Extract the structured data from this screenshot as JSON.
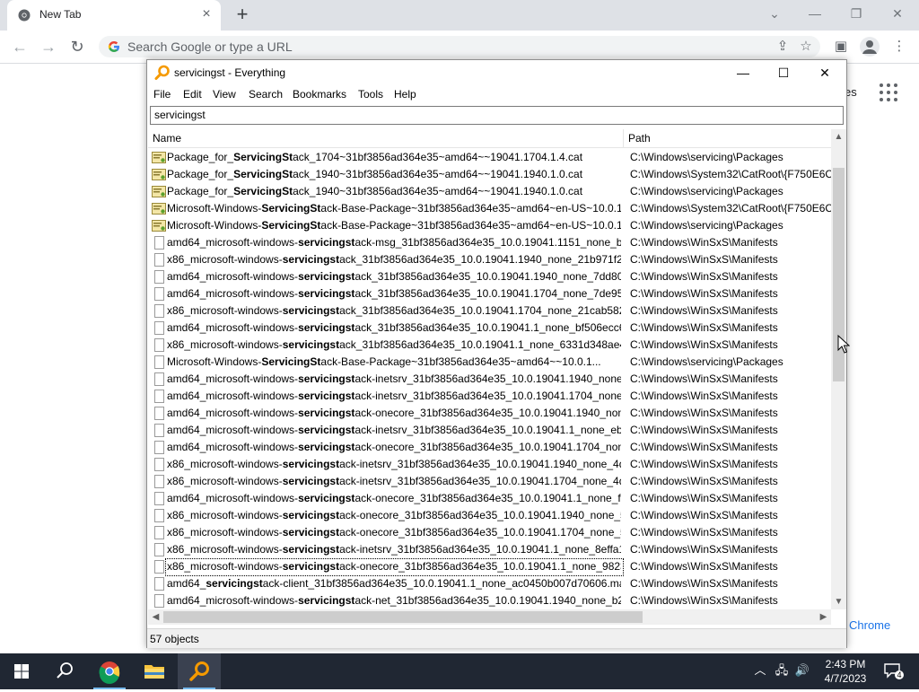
{
  "chrome": {
    "tab_title": "New Tab",
    "new_tab_label": "+",
    "omnibox_placeholder": "Search Google or type a URL",
    "ntp_link_partial": "es",
    "ntp_chrome_partial": "Chrome"
  },
  "everything": {
    "window_title": "servicingst - Everything",
    "menu": [
      "File",
      "Edit",
      "View",
      "Search",
      "Bookmarks",
      "Tools",
      "Help"
    ],
    "search_value": "servicingst",
    "columns": {
      "name": "Name",
      "path": "Path"
    },
    "rows": [
      {
        "icon": "cat",
        "pre": "Package_for_",
        "match": "ServicingSt",
        "post": "ack_1704~31bf3856ad364e35~amd64~~19041.1704.1.4.cat",
        "path": "C:\\Windows\\servicing\\Packages"
      },
      {
        "icon": "cat",
        "pre": "Package_for_",
        "match": "ServicingSt",
        "post": "ack_1940~31bf3856ad364e35~amd64~~19041.1940.1.0.cat",
        "path": "C:\\Windows\\System32\\CatRoot\\{F750E6C3"
      },
      {
        "icon": "cat",
        "pre": "Package_for_",
        "match": "ServicingSt",
        "post": "ack_1940~31bf3856ad364e35~amd64~~19041.1940.1.0.cat",
        "path": "C:\\Windows\\servicing\\Packages"
      },
      {
        "icon": "cat",
        "pre": "Microsoft-Windows-",
        "match": "ServicingSt",
        "post": "ack-Base-Package~31bf3856ad364e35~amd64~en-US~10.0.1...",
        "path": "C:\\Windows\\System32\\CatRoot\\{F750E6C3"
      },
      {
        "icon": "cat",
        "pre": "Microsoft-Windows-",
        "match": "ServicingSt",
        "post": "ack-Base-Package~31bf3856ad364e35~amd64~en-US~10.0.1...",
        "path": "C:\\Windows\\servicing\\Packages"
      },
      {
        "icon": "doc",
        "pre": "amd64_microsoft-windows-",
        "match": "servicingst",
        "post": "ack-msg_31bf3856ad364e35_10.0.19041.1151_none_b36...",
        "path": "C:\\Windows\\WinSxS\\Manifests"
      },
      {
        "icon": "doc",
        "pre": "x86_microsoft-windows-",
        "match": "servicingst",
        "post": "ack_31bf3856ad364e35_10.0.19041.1940_none_21b971f2c45...",
        "path": "C:\\Windows\\WinSxS\\Manifests"
      },
      {
        "icon": "doc",
        "pre": "amd64_microsoft-windows-",
        "match": "servicingst",
        "post": "ack_31bf3856ad364e35_10.0.19041.1940_none_7dd80d7...",
        "path": "C:\\Windows\\WinSxS\\Manifests"
      },
      {
        "icon": "doc",
        "pre": "amd64_microsoft-windows-",
        "match": "servicingst",
        "post": "ack_31bf3856ad364e35_10.0.19041.1704_none_7de9510...",
        "path": "C:\\Windows\\WinSxS\\Manifests"
      },
      {
        "icon": "doc",
        "pre": "x86_microsoft-windows-",
        "match": "servicingst",
        "post": "ack_31bf3856ad364e35_10.0.19041.1704_none_21cab582c4...",
        "path": "C:\\Windows\\WinSxS\\Manifests"
      },
      {
        "icon": "doc",
        "pre": "amd64_microsoft-windows-",
        "match": "servicingst",
        "post": "ack_31bf3856ad364e35_10.0.19041.1_none_bf506ecc66a...",
        "path": "C:\\Windows\\WinSxS\\Manifests"
      },
      {
        "icon": "doc",
        "pre": "x86_microsoft-windows-",
        "match": "servicingst",
        "post": "ack_31bf3856ad364e35_10.0.19041.1_none_6331d348ae4a8f...",
        "path": "C:\\Windows\\WinSxS\\Manifests"
      },
      {
        "icon": "doc",
        "pre": "Microsoft-Windows-",
        "match": "ServicingSt",
        "post": "ack-Base-Package~31bf3856ad364e35~amd64~~10.0.1...",
        "path": "C:\\Windows\\servicing\\Packages"
      },
      {
        "icon": "doc",
        "pre": "amd64_microsoft-windows-",
        "match": "servicingst",
        "post": "ack-inetsrv_31bf3856ad364e35_10.0.19041.1940_none_a...",
        "path": "C:\\Windows\\WinSxS\\Manifests"
      },
      {
        "icon": "doc",
        "pre": "amd64_microsoft-windows-",
        "match": "servicingst",
        "post": "ack-inetsrv_31bf3856ad364e35_10.0.19041.1704_none_a...",
        "path": "C:\\Windows\\WinSxS\\Manifests"
      },
      {
        "icon": "doc",
        "pre": "amd64_microsoft-windows-",
        "match": "servicingst",
        "post": "ack-onecore_31bf3856ad364e35_10.0.19041.1940_none...",
        "path": "C:\\Windows\\WinSxS\\Manifests"
      },
      {
        "icon": "doc",
        "pre": "amd64_microsoft-windows-",
        "match": "servicingst",
        "post": "ack-inetsrv_31bf3856ad364e35_10.0.19041.1_none_eb1e...",
        "path": "C:\\Windows\\WinSxS\\Manifests"
      },
      {
        "icon": "doc",
        "pre": "amd64_microsoft-windows-",
        "match": "servicingst",
        "post": "ack-onecore_31bf3856ad364e35_10.0.19041.1704_none...",
        "path": "C:\\Windows\\WinSxS\\Manifests"
      },
      {
        "icon": "doc",
        "pre": "x86_microsoft-windows-",
        "match": "servicingst",
        "post": "ack-inetsrv_31bf3856ad364e35_10.0.19041.1940_none_4d87...",
        "path": "C:\\Windows\\WinSxS\\Manifests"
      },
      {
        "icon": "doc",
        "pre": "x86_microsoft-windows-",
        "match": "servicingst",
        "post": "ack-inetsrv_31bf3856ad364e35_10.0.19041.1704_none_4d98...",
        "path": "C:\\Windows\\WinSxS\\Manifests"
      },
      {
        "icon": "doc",
        "pre": "amd64_microsoft-windows-",
        "match": "servicingst",
        "post": "ack-onecore_31bf3856ad364e35_10.0.19041.1_none_f44...",
        "path": "C:\\Windows\\WinSxS\\Manifests"
      },
      {
        "icon": "doc",
        "pre": "x86_microsoft-windows-",
        "match": "servicingst",
        "post": "ack-onecore_31bf3856ad364e35_10.0.19041.1940_none_56...",
        "path": "C:\\Windows\\WinSxS\\Manifests"
      },
      {
        "icon": "doc",
        "pre": "x86_microsoft-windows-",
        "match": "servicingst",
        "post": "ack-onecore_31bf3856ad364e35_10.0.19041.1704_none_56...",
        "path": "C:\\Windows\\WinSxS\\Manifests"
      },
      {
        "icon": "doc",
        "pre": "x86_microsoft-windows-",
        "match": "servicingst",
        "post": "ack-inetsrv_31bf3856ad364e35_10.0.19041.1_none_8effa1b...",
        "path": "C:\\Windows\\WinSxS\\Manifests"
      },
      {
        "icon": "doc",
        "pre": "x86_microsoft-windows-",
        "match": "servicingst",
        "post": "ack-onecore_31bf3856ad364e35_10.0.19041.1_none_98236...",
        "path": "C:\\Windows\\WinSxS\\Manifests",
        "focused": true
      },
      {
        "icon": "doc",
        "pre": "amd64_",
        "match": "servicingst",
        "post": "ack-client_31bf3856ad364e35_10.0.19041.1_none_ac0450b007d70606.manifest",
        "path": "C:\\Windows\\WinSxS\\Manifests"
      },
      {
        "icon": "doc",
        "pre": "amd64_microsoft-windows-",
        "match": "servicingst",
        "post": "ack-net_31bf3856ad364e35_10.0.19041.1940_none_b2fe...",
        "path": "C:\\Windows\\WinSxS\\Manifests"
      }
    ],
    "status_text": "57 objects"
  },
  "taskbar": {
    "time": "2:43 PM",
    "date": "4/7/2023",
    "notification_count": "4"
  },
  "colors": {
    "taskbar_bg": "#202733",
    "chrome_tabstrip": "#dee1e6",
    "everything_accent": "#f59a00",
    "link_blue": "#1a73e8"
  }
}
